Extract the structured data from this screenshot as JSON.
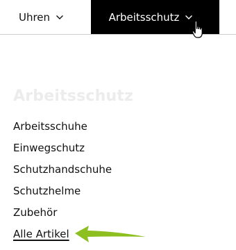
{
  "topnav": {
    "items": [
      {
        "label": "Uhren",
        "icon": "chevron-down-icon",
        "active": false
      },
      {
        "label": "Arbeitsschutz",
        "icon": "chevron-down-icon",
        "active": true
      }
    ]
  },
  "dropdown": {
    "title": "Arbeitsschutz",
    "links": [
      "Arbeitsschuhe",
      "Einwegschutz",
      "Schutzhandschuhe",
      "Schutzhelme",
      "Zubehör",
      "Alle Artikel"
    ]
  },
  "colors": {
    "active_bg": "#000000",
    "active_text": "#ffffff",
    "title_faded": "#ececec",
    "annotation_arrow": "#8cbf1f"
  }
}
